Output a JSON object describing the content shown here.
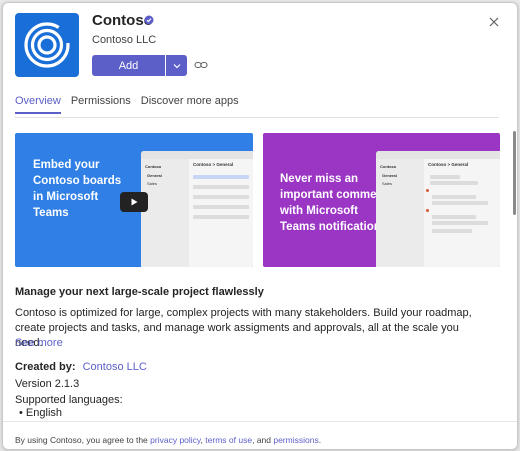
{
  "app": {
    "name": "Contoso",
    "publisher": "Contoso LLC",
    "tile_color": "#1a6ed8",
    "verified_icon": "verified-badge-icon"
  },
  "actions": {
    "add_label": "Add",
    "dropdown_icon": "chevron-down-icon",
    "copy_link_icon": "link-icon",
    "close_icon": "close-icon",
    "accent_color": "#5b5fc7"
  },
  "tabs": [
    {
      "label": "Overview",
      "active": true
    },
    {
      "label": "Permissions",
      "active": false
    },
    {
      "label": "Discover more apps",
      "active": false
    }
  ],
  "banners": [
    {
      "text": "Embed your Contoso boards in Microsoft Teams",
      "color": "#2f7fe6",
      "mock": {
        "title": "Contoso > General",
        "side_header": "Contoso",
        "side_items": [
          "General",
          "Sales"
        ]
      },
      "has_play_button": true
    },
    {
      "text": "Never miss an important comment with Microsoft Teams notifications",
      "color": "#9b35c4",
      "mock": {
        "title": "Contoso > General",
        "side_header": "Contoso",
        "side_items": [
          "General",
          "Sales"
        ]
      },
      "has_play_button": false
    }
  ],
  "details": {
    "headline": "Manage your next large-scale project flawlessly",
    "description": "Contoso is optimized for large, complex projects with many stakeholders. Build your roadmap, create projects and tasks, and manage work assigments and approvals, all at the scale you need.",
    "see_more": "See more",
    "created_by_label": "Created by:",
    "created_by_value": "Contoso LLC",
    "version": "Version 2.1.3",
    "languages_label": "Supported languages:",
    "languages": [
      "English"
    ]
  },
  "footer": {
    "prefix": "By using Contoso, you agree to the ",
    "privacy_link": "privacy policy",
    "sep1": ", ",
    "terms_link": "terms of use",
    "sep2": ", and ",
    "permissions_link": "permissions",
    "suffix": "."
  }
}
